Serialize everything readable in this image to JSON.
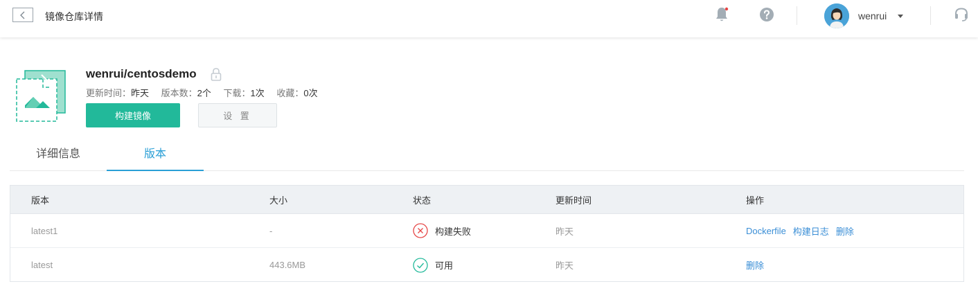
{
  "header": {
    "title": "镜像仓库详情",
    "username": "wenrui",
    "notification_dot_color": "#e64545"
  },
  "repo": {
    "name": "wenrui/centosdemo",
    "meta": {
      "updated_label": "更新时间：",
      "updated_value": "昨天",
      "versions_label": "版本数：",
      "versions_value": "2个",
      "downloads_label": "下载：",
      "downloads_value": "1次",
      "favorites_label": "收藏：",
      "favorites_value": "0次"
    },
    "build_button": "构建镜像",
    "settings_button": "设 置"
  },
  "tabs": [
    {
      "label": "详细信息",
      "active": false
    },
    {
      "label": "版本",
      "active": true
    }
  ],
  "table": {
    "columns": [
      "版本",
      "大小",
      "状态",
      "更新时间",
      "操作"
    ],
    "rows": [
      {
        "version": "latest1",
        "size": "-",
        "status": "构建失败",
        "status_icon": "error-circle-icon",
        "updated": "昨天",
        "actions": [
          "Dockerfile",
          "构建日志",
          "删除"
        ]
      },
      {
        "version": "latest",
        "size": "443.6MB",
        "status": "可用",
        "status_icon": "check-circle-icon",
        "updated": "昨天",
        "actions": [
          "删除"
        ]
      }
    ]
  },
  "colors": {
    "accent": "#22b99a",
    "link": "#3a8ed6",
    "tab_active": "#2a9fd6",
    "error": "#e64545",
    "success": "#22b99a"
  }
}
